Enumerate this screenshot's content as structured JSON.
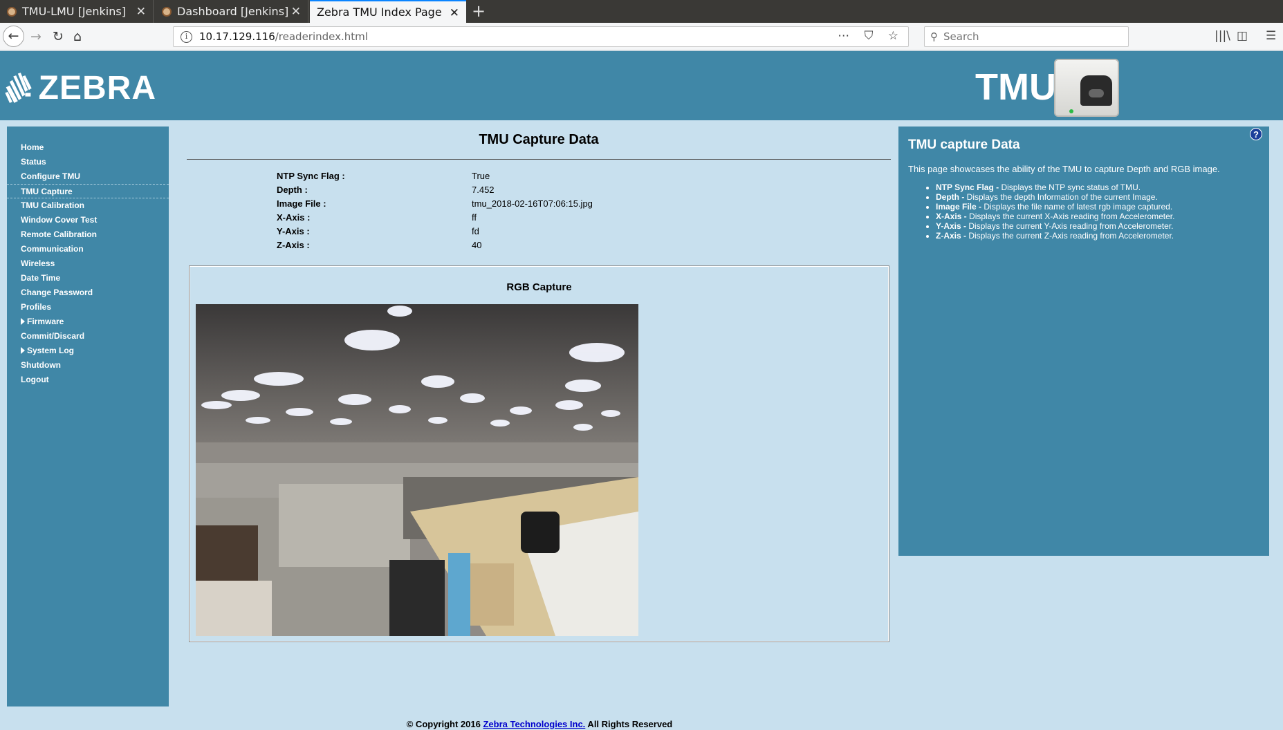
{
  "browser": {
    "tabs": [
      {
        "title": "TMU-LMU [Jenkins]"
      },
      {
        "title": "Dashboard [Jenkins]"
      },
      {
        "title": "Zebra TMU Index Page"
      }
    ],
    "url_host": "10.17.129.116",
    "url_path": "/readerindex.html",
    "search_placeholder": "Search"
  },
  "header": {
    "brand": "ZEBRA",
    "product": "TMU"
  },
  "sidebar": {
    "items": [
      {
        "label": "Home"
      },
      {
        "label": "Status"
      },
      {
        "label": "Configure TMU"
      },
      {
        "label": "TMU Capture"
      },
      {
        "label": "TMU Calibration"
      },
      {
        "label": "Window Cover Test"
      },
      {
        "label": "Remote Calibration"
      },
      {
        "label": "Communication"
      },
      {
        "label": "Wireless"
      },
      {
        "label": "Date Time"
      },
      {
        "label": "Change Password"
      },
      {
        "label": "Profiles"
      },
      {
        "label": "Firmware"
      },
      {
        "label": "Commit/Discard"
      },
      {
        "label": "System Log"
      },
      {
        "label": "Shutdown"
      },
      {
        "label": "Logout"
      }
    ]
  },
  "main": {
    "title": "TMU Capture Data",
    "fields": [
      {
        "label": "NTP Sync Flag :",
        "value": "True"
      },
      {
        "label": "Depth :",
        "value": "7.452"
      },
      {
        "label": "Image File :",
        "value": "tmu_2018-02-16T07:06:15.jpg"
      },
      {
        "label": "X-Axis :",
        "value": "ff"
      },
      {
        "label": "Y-Axis :",
        "value": "fd"
      },
      {
        "label": "Z-Axis :",
        "value": "40"
      }
    ],
    "capture_title": "RGB Capture"
  },
  "help": {
    "title": "TMU capture Data",
    "description": "This page showcases the ability of the TMU to capture Depth and RGB image.",
    "items": [
      {
        "term": "NTP Sync Flag -",
        "text": " Displays the NTP sync status of TMU."
      },
      {
        "term": "Depth -",
        "text": " Displays the depth Information of the current Image."
      },
      {
        "term": "Image File -",
        "text": " Displays the file name of latest rgb image captured."
      },
      {
        "term": "X-Axis -",
        "text": " Displays the current X-Axis reading from Accelerometer."
      },
      {
        "term": "Y-Axis -",
        "text": " Displays the current Y-Axis reading from Accelerometer."
      },
      {
        "term": "Z-Axis -",
        "text": " Displays the current Z-Axis reading from Accelerometer."
      }
    ],
    "help_glyph": "?"
  },
  "footer": {
    "prefix": "© Copyright 2016 ",
    "link": "Zebra Technologies Inc.",
    "suffix": " All Rights Reserved"
  },
  "colors": {
    "header_bg": "#4087a7",
    "page_bg": "#c8e0ee",
    "link": "#0000cc"
  }
}
